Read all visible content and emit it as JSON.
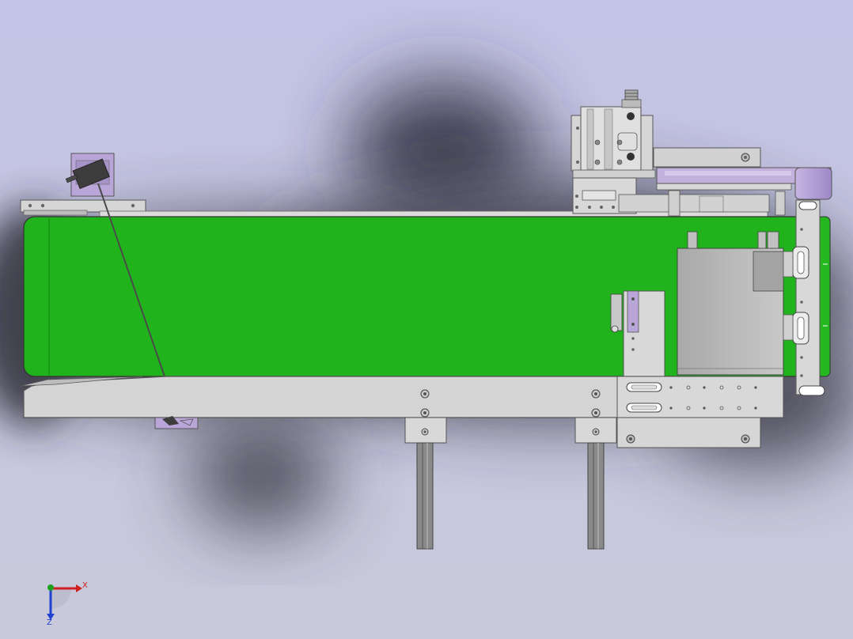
{
  "viewport": {
    "background_top": "#c4c4e6",
    "background_bottom": "#c8c8dc",
    "shadow_color": "#2a2a38"
  },
  "model": {
    "belt_color": "#22b41c",
    "belt_highlight": "#3ac233",
    "frame_color": "#d4d4d4",
    "frame_edge": "#5a5a5a",
    "accent_part_color": "#b9a5d8",
    "dark_part_color": "#3d3d3d"
  },
  "triad": {
    "x_label": "X",
    "z_label": "Z",
    "x_color": "#d02020",
    "y_color": "#20a020",
    "z_color": "#2040d0"
  }
}
